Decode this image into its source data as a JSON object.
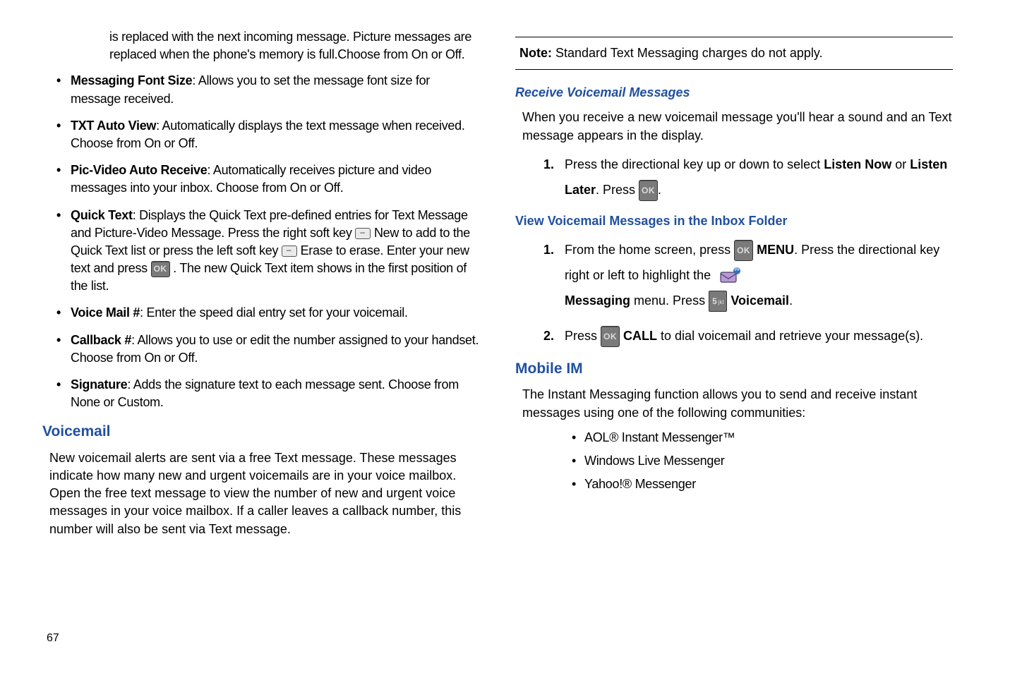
{
  "leftColumn": {
    "introParagraph": "is replaced with the next incoming message. Picture messages are replaced when the phone's memory is full.Choose from On or Off.",
    "bullets": {
      "fontSize": {
        "label": "Messaging Font Size",
        "text": ": Allows you to set the message font size for message received."
      },
      "autoView": {
        "label": "TXT Auto View",
        "text": ": Automatically displays the text message when received. Choose from On or Off."
      },
      "autoReceive": {
        "label": "Pic-Video Auto Receive",
        "text": ": Automatically receives picture and video messages into your inbox. Choose from On or Off."
      },
      "quickText": {
        "label": "Quick Text",
        "textA": ": Displays the Quick Text pre-defined entries for Text Message and Picture-Video Message. Press the right soft key ",
        "textB": " New to add to the Quick Text list or press the left soft key ",
        "textC": " Erase to erase. Enter your new text and press ",
        "textD": " . The new Quick Text item shows in the first position of the list."
      },
      "voiceMailNum": {
        "label": "Voice Mail #",
        "text": ": Enter the speed dial entry set for your voicemail."
      },
      "callback": {
        "label": "Callback #",
        "text": ": Allows you to use or edit the number assigned to your handset. Choose from On or Off."
      },
      "signature": {
        "label": "Signature",
        "text": ": Adds the signature text to each message sent. Choose from None or Custom."
      }
    },
    "voicemailHeading": "Voicemail",
    "voicemailPara": "New voicemail alerts are sent via a free Text message. These messages indicate how many new and urgent voicemails are in your voice mailbox. Open the free text message to view the number of new and urgent voice messages in your voice mailbox. If a caller leaves a callback number, this number will also be sent via Text message."
  },
  "rightColumn": {
    "note": {
      "label": "Note:",
      "text": " Standard Text Messaging charges do not apply."
    },
    "receiveHeading": "Receive Voicemail Messages",
    "receivePara": "When you receive a new voicemail message you'll hear a sound and an Text message appears in the display.",
    "receiveStep1": {
      "num": "1.",
      "textA": "Press the directional key up or down to select ",
      "boldA": "Listen Now",
      "textB": " or ",
      "boldB": "Listen Later",
      "textC": ". Press ",
      "textD": "."
    },
    "viewHeading": "View Voicemail Messages in the Inbox Folder",
    "viewStep1": {
      "num": "1.",
      "textA": "From the home screen, press ",
      "boldA": "MENU",
      "textB": ". Press the directional key right or left to highlight the ",
      "boldB": "Messaging",
      "textC": " menu. Press ",
      "boldC": "Voicemail",
      "textD": "."
    },
    "viewStep2": {
      "num": "2.",
      "textA": "Press ",
      "boldA": "CALL",
      "textB": " to dial voicemail and retrieve your message(s)."
    },
    "mobileIMHeading": "Mobile IM",
    "mobileIMPara": "The Instant Messaging function allows you to send and receive instant messages using one of the following communities:",
    "imList": {
      "aol": "AOL® Instant Messenger™",
      "wlm": "Windows Live Messenger",
      "yahoo": "Yahoo!® Messenger"
    }
  },
  "pageNumber": "67",
  "keys": {
    "ok": "OK"
  }
}
